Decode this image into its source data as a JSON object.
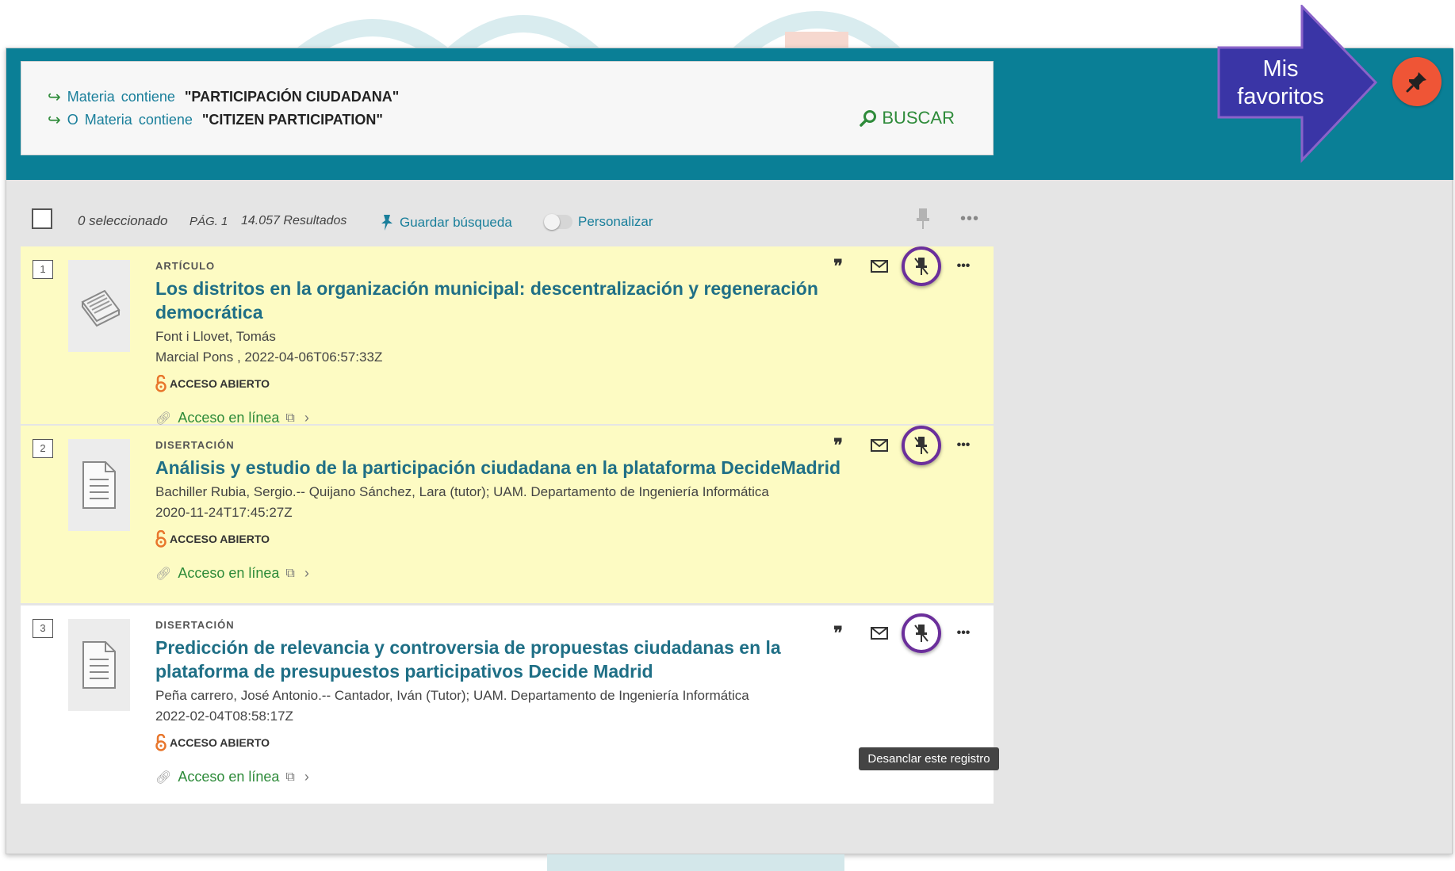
{
  "query": {
    "lines": [
      {
        "prefix": "",
        "field": "Materia",
        "op": "contiene",
        "value": "\"PARTICIPACIÓN CIUDADANA\""
      },
      {
        "prefix": "O",
        "field": "Materia",
        "op": "contiene",
        "value": "\"CITIZEN PARTICIPATION\""
      }
    ],
    "search_label": "BUSCAR"
  },
  "toolbar": {
    "selected": "0 seleccionado",
    "page": "PÁG. 1",
    "results": "14.057 Resultados",
    "save_search": "Guardar búsqueda",
    "personalize": "Personalizar"
  },
  "records": [
    {
      "num": "1",
      "type": "ARTÍCULO",
      "title": "Los distritos en la organización municipal: descentralización y regeneración democrática",
      "author": "Font i Llovet, Tomás",
      "publisher": "Marcial Pons , 2022-04-06T06:57:33Z",
      "open_access": "ACCESO ABIERTO",
      "online": "Acceso en línea"
    },
    {
      "num": "2",
      "type": "DISERTACIÓN",
      "title": "Análisis y estudio de la participación ciudadana en la plataforma DecideMadrid",
      "author": "Bachiller Rubia, Sergio.-- Quijano Sánchez, Lara (tutor); UAM. Departamento de Ingeniería Informática",
      "publisher": "2020-11-24T17:45:27Z",
      "open_access": "ACCESO ABIERTO",
      "online": "Acceso en línea"
    },
    {
      "num": "3",
      "type": "DISERTACIÓN",
      "title": "Predicción de relevancia y controversia de propuestas ciudadanas en la plataforma de presupuestos participativos Decide Madrid",
      "author": "Peña carrero, José Antonio.-- Cantador, Iván (Tutor); UAM. Departamento de Ingeniería Informática",
      "publisher": "2022-02-04T08:58:17Z",
      "open_access": "ACCESO ABIERTO",
      "online": "Acceso en línea"
    }
  ],
  "tooltip": "Desanclar este registro",
  "callout": {
    "line1": "Mis",
    "line2": "favoritos"
  },
  "icons": {
    "cite": "quote-icon",
    "email": "envelope-icon",
    "unpin": "unpin-icon",
    "more": "more-icon",
    "favorites": "pin-icon"
  },
  "colors": {
    "header": "#0a7f96",
    "highlight_row": "#fdfbc3",
    "accent_green": "#2e8b3a",
    "title_blue": "#1f6f86",
    "pin_circle": "#6b2f9b",
    "callout_arrow": "#3a35a6",
    "favorites_button": "#ef5536"
  }
}
